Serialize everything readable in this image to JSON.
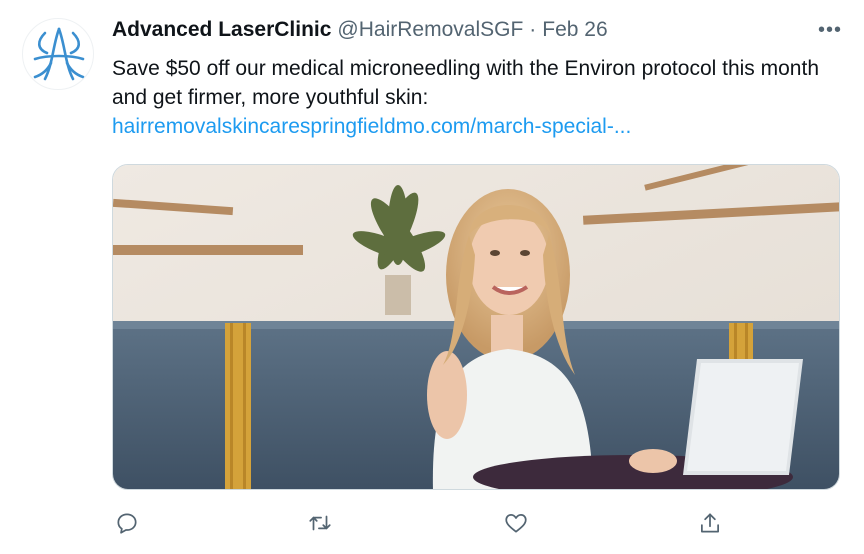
{
  "tweet": {
    "display_name": "Advanced LaserClinic",
    "handle": "@HairRemovalSGF",
    "separator": "·",
    "date": "Feb 26",
    "more_label": "•••",
    "text": "Save $50 off our medical microneedling with the Environ protocol this month and get firmer, more youthful skin:",
    "link_text": "hairremovalskincarespringfieldmo.com/march-special-..."
  },
  "actions": [
    {
      "icon": "reply-icon"
    },
    {
      "icon": "retweet-icon"
    },
    {
      "icon": "like-icon"
    },
    {
      "icon": "share-icon"
    }
  ],
  "colors": {
    "link": "#1d9bf0",
    "secondary_text": "#536471",
    "brand_logo": "#3b8fd0"
  }
}
